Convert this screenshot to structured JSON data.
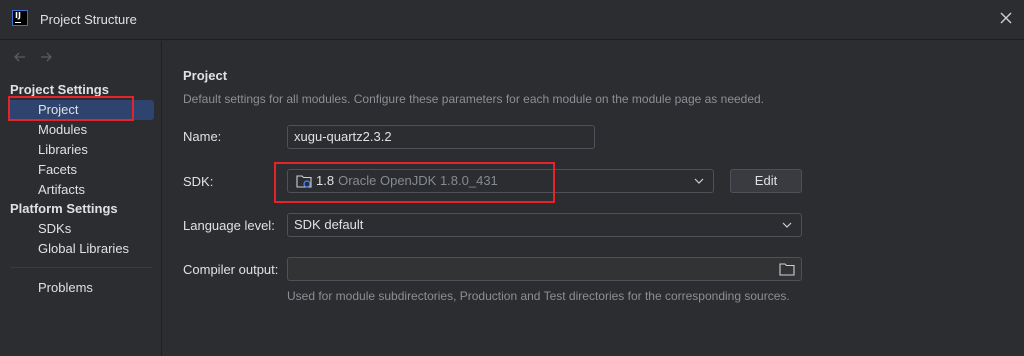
{
  "window": {
    "title": "Project Structure"
  },
  "sidebar": {
    "project_settings_title": "Project Settings",
    "project_items": [
      "Project",
      "Modules",
      "Libraries",
      "Facets",
      "Artifacts"
    ],
    "platform_settings_title": "Platform Settings",
    "platform_items": [
      "SDKs",
      "Global Libraries"
    ],
    "problems_label": "Problems",
    "selected": "Project"
  },
  "main": {
    "title": "Project",
    "description": "Default settings for all modules. Configure these parameters for each module on the module page as needed.",
    "name": {
      "label": "Name:",
      "value": "xugu-quartz2.3.2"
    },
    "sdk": {
      "label": "SDK:",
      "version": "1.8",
      "name": "Oracle OpenJDK 1.8.0_431",
      "edit_label": "Edit"
    },
    "language_level": {
      "label": "Language level:",
      "value": "SDK default"
    },
    "compiler_output": {
      "label": "Compiler output:",
      "value": "",
      "hint": "Used for module subdirectories, Production and Test directories for the corresponding sources."
    }
  },
  "colors": {
    "accent_red": "#e5232b",
    "selection": "#2e436e",
    "background": "#2b2d30"
  }
}
